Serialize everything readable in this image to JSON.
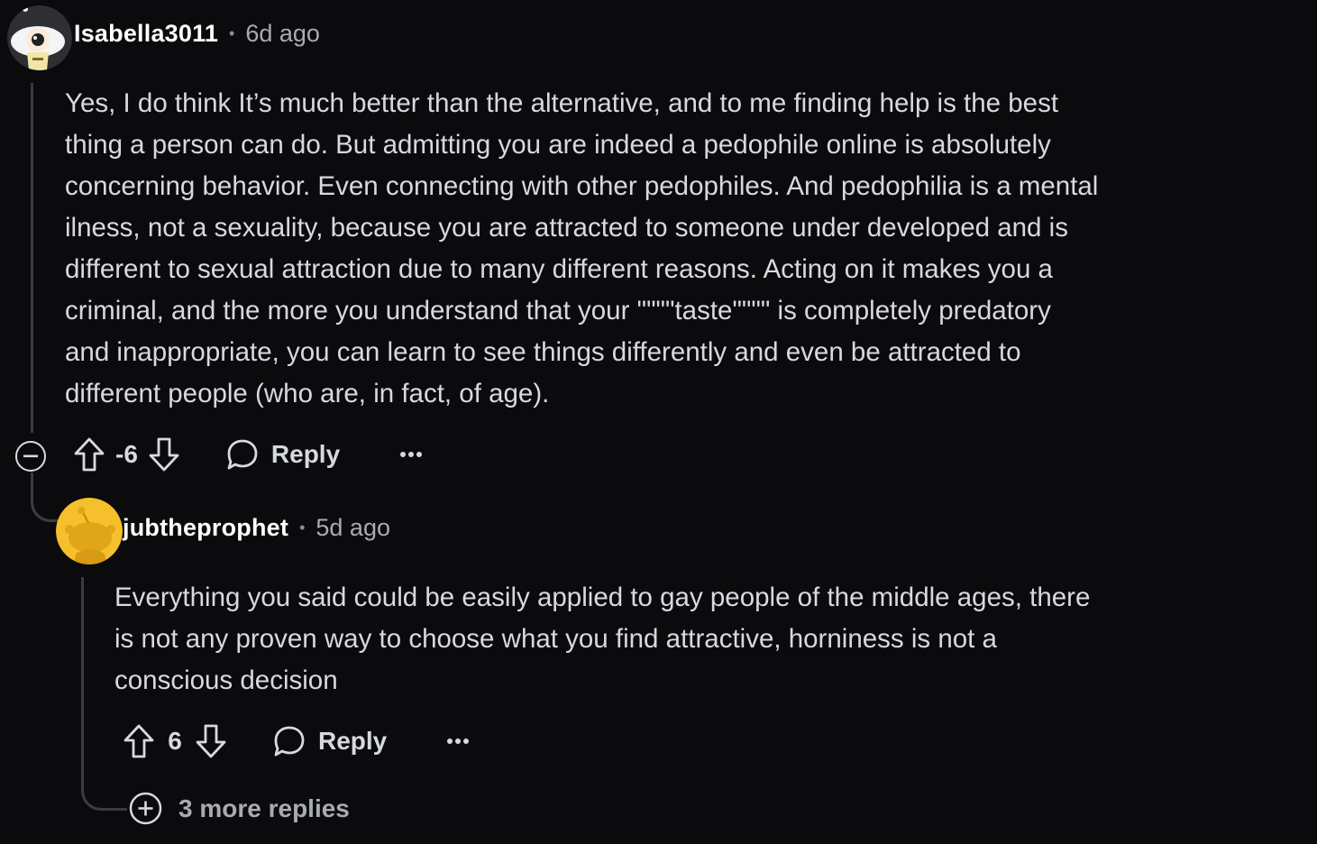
{
  "comments": [
    {
      "username": "Isabella3011",
      "separator": "•",
      "time": "6d ago",
      "body": "Yes, I do think It’s much better than the alternative, and to me finding help is the best\nthing a person can do. But admitting you are indeed a pedophile online is absolutely\nconcerning behavior. Even connecting with other pedophiles. And pedophilia is a mental\nilness, not a sexuality, because you are attracted to someone under developed and is\ndifferent to sexual attraction due to many different reasons. Acting on it makes you a\ncriminal, and the more you understand that your \"\"\"\"taste\"\"\"\" is completely predatory\nand inappropriate, you can learn to see things differently and even be attracted to\ndifferent people (who are, in fact, of age).",
      "score": "-6",
      "reply_label": "Reply",
      "more_label": "···"
    },
    {
      "username": "jubtheprophet",
      "separator": "•",
      "time": "5d ago",
      "body": "Everything you said could be easily applied to gay people of the middle ages, there\nis not any proven way to choose what you find attractive, horniness is not a\nconscious decision",
      "score": "6",
      "reply_label": "Reply",
      "more_label": "···"
    }
  ],
  "more_replies_label": "3 more replies",
  "icons": {
    "collapse": "minus-circle-icon",
    "expand": "plus-circle-icon",
    "upvote": "arrow-up-icon",
    "downvote": "arrow-down-icon",
    "reply": "speech-bubble-icon",
    "more": "ellipsis-icon"
  },
  "colors": {
    "background": "#0b0b0d",
    "text": "#d7dadc",
    "muted": "#a8acb0",
    "thread_line": "#3a3d40",
    "avatar_yellow": "#f6c02c"
  }
}
